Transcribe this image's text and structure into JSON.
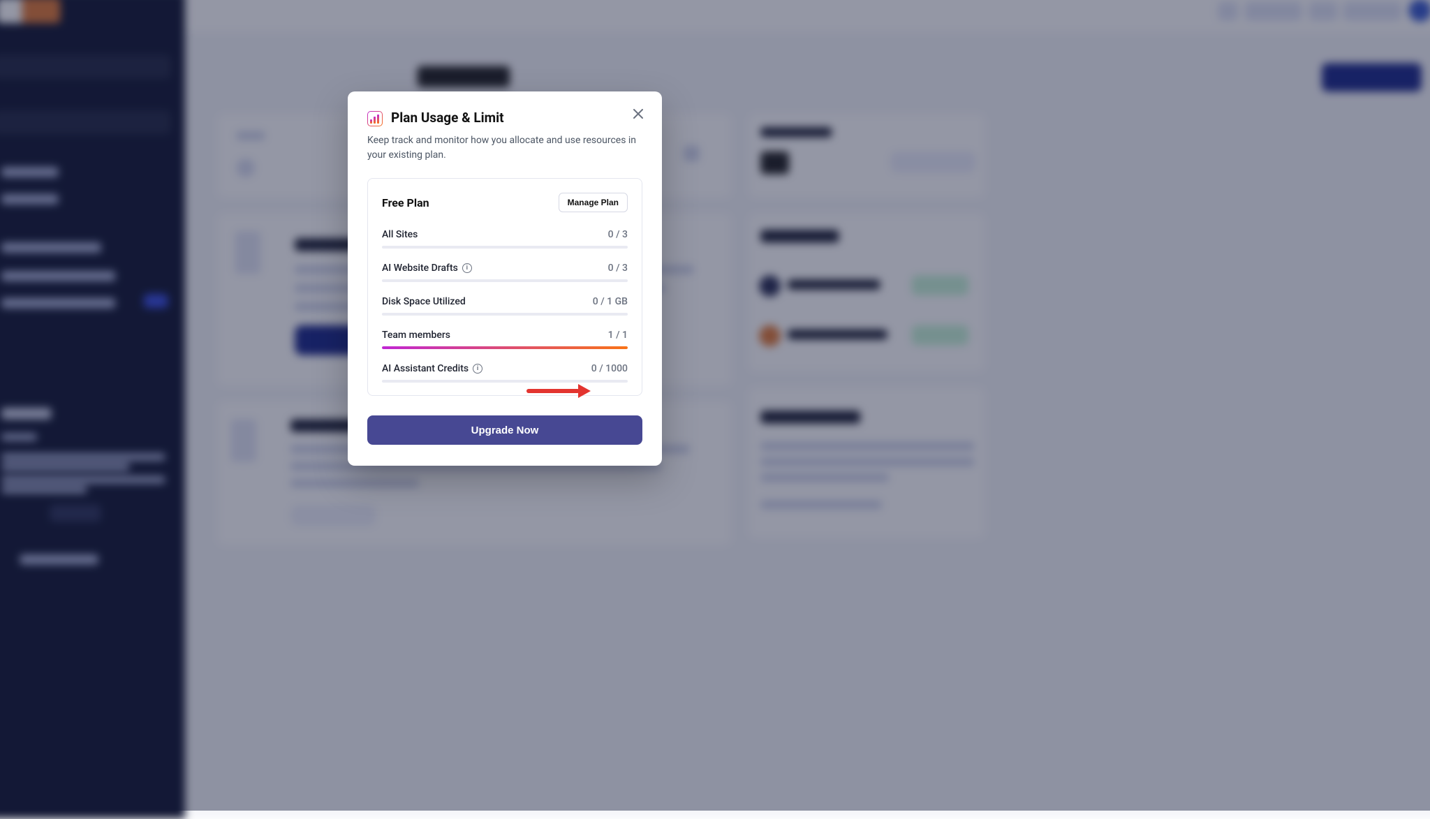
{
  "modal": {
    "title": "Plan Usage & Limit",
    "description": "Keep track and monitor how you allocate and use resources in your existing plan.",
    "plan_name": "Free Plan",
    "manage_label": "Manage Plan",
    "upgrade_label": "Upgrade Now",
    "metrics": [
      {
        "label": "All Sites",
        "value": "0 / 3",
        "fill_pct": 0,
        "info": false
      },
      {
        "label": "AI Website Drafts",
        "value": "0 / 3",
        "fill_pct": 0,
        "info": true
      },
      {
        "label": "Disk Space Utilized",
        "value": "0 / 1 GB",
        "fill_pct": 0,
        "info": false
      },
      {
        "label": "Team members",
        "value": "1 / 1",
        "fill_pct": 100,
        "info": false
      },
      {
        "label": "AI Assistant Credits",
        "value": "0 / 1000",
        "fill_pct": 0,
        "info": true
      }
    ]
  }
}
